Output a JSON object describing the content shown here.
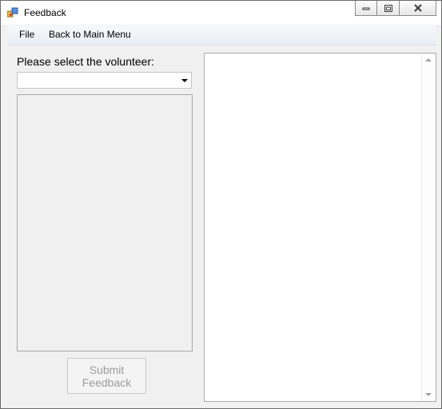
{
  "window": {
    "title": "Feedback",
    "controls": [
      {
        "name": "minimize-icon"
      },
      {
        "name": "restore-icon"
      },
      {
        "name": "close-icon"
      }
    ]
  },
  "menu": {
    "file": "File",
    "back": "Back to Main Menu"
  },
  "form": {
    "select_label": "Please select the volunteer:",
    "volunteer_selected": "",
    "submit_label": "Submit Feedback"
  },
  "feedback_text": ""
}
